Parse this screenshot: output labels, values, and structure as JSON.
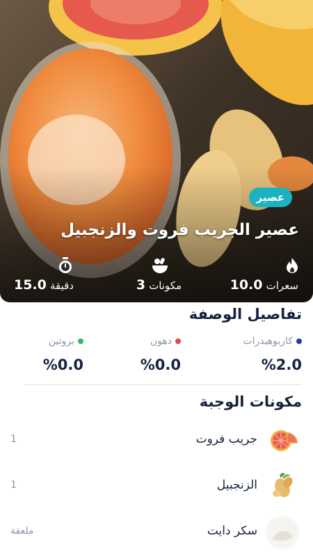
{
  "recipe": {
    "category": "عصير",
    "title": "عصير الجريب فروت والزنجبيل",
    "stats": {
      "calories": {
        "value": "10.0",
        "unit": "سعرات"
      },
      "ingredients": {
        "value": "3",
        "unit": "مكونات"
      },
      "time": {
        "value": "15.0",
        "unit": "دقيقة"
      }
    }
  },
  "details": {
    "heading": "تفاصيل الوصفة",
    "macros": [
      {
        "label": "كاربوهيدرات",
        "value": "%2.0",
        "color": "#1f3fa8"
      },
      {
        "label": "دهون",
        "value": "%0.0",
        "color": "#e04747"
      },
      {
        "label": "بروتين",
        "value": "%0.0",
        "color": "#2dbb5f"
      }
    ]
  },
  "ingredients": {
    "heading": "مكونات الوجبة",
    "items": [
      {
        "name": "جريب فروت",
        "qty": "1",
        "icon": "grapefruit-icon"
      },
      {
        "name": "الزنجبيل",
        "qty": "1",
        "icon": "ginger-icon"
      },
      {
        "name": "سكر دايت",
        "qty": "ملعقة",
        "icon": "sugar-icon"
      }
    ]
  }
}
